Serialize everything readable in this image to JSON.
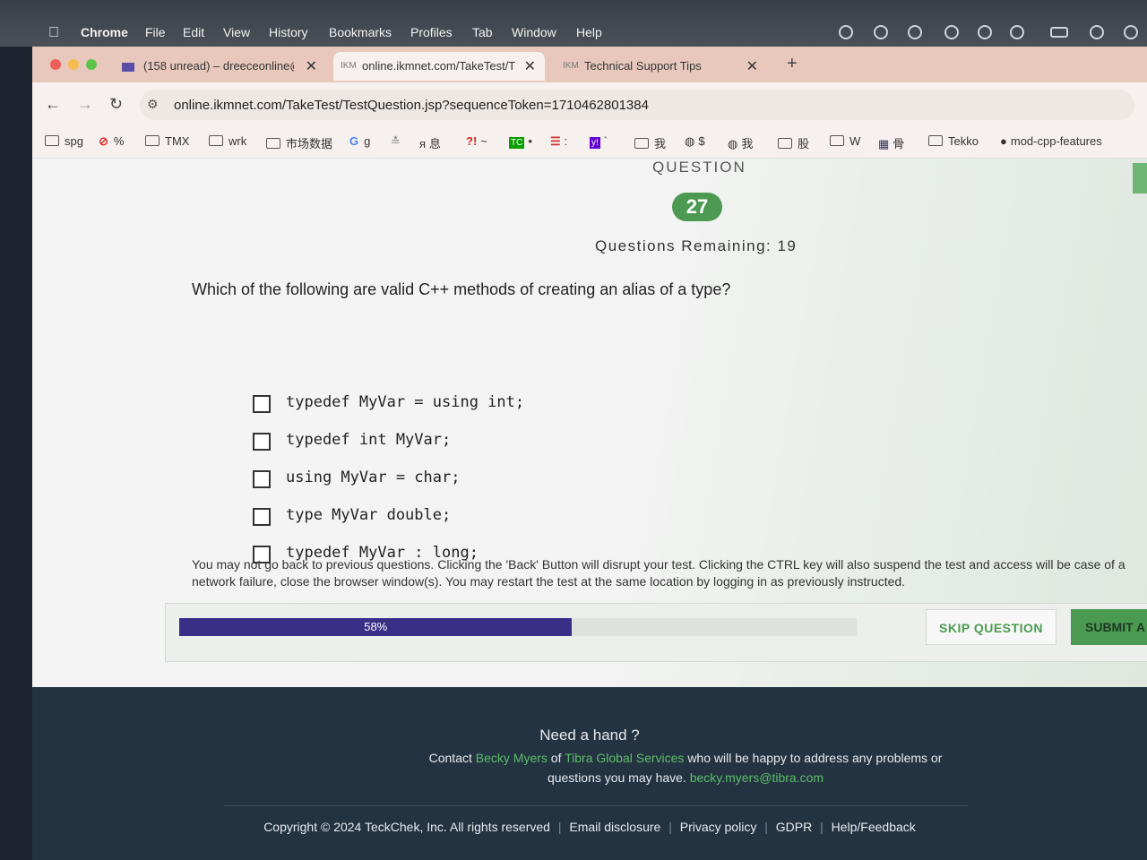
{
  "menubar": {
    "apple_icon": "apple-icon",
    "items": [
      "Chrome",
      "File",
      "Edit",
      "View",
      "History",
      "Bookmarks",
      "Profiles",
      "Tab",
      "Window",
      "Help"
    ]
  },
  "tabs": [
    {
      "icon": "mail-icon",
      "title": "(158 unread) – dreeceonline@"
    },
    {
      "icon": "IKM",
      "title": "online.ikmnet.com/TakeTest/T"
    },
    {
      "icon": "IKM",
      "title": "Technical Support Tips"
    }
  ],
  "new_tab_glyph": "+",
  "tab_close_glyph": "✕",
  "toolbar": {
    "back": "←",
    "forward": "→",
    "reload": "↻",
    "url": "online.ikmnet.com/TakeTest/TestQuestion.jsp?sequenceToken=1710462801384"
  },
  "bookmarks": [
    {
      "icon": "folder-icon",
      "label": "spg"
    },
    {
      "icon": "blocked-icon",
      "label": "%"
    },
    {
      "icon": "folder-icon",
      "label": "TMX"
    },
    {
      "icon": "folder-icon",
      "label": "wrk"
    },
    {
      "icon": "folder-icon",
      "label": "市场数据"
    },
    {
      "icon": "google-icon",
      "label": "g"
    },
    {
      "icon": "site-icon",
      "label": ""
    },
    {
      "icon": "site-icon",
      "label": "息"
    },
    {
      "icon": "site-icon",
      "label": "~"
    },
    {
      "icon": "site-icon",
      "label": "•"
    },
    {
      "icon": "site-icon",
      "label": ":"
    },
    {
      "icon": "yahoo-icon",
      "label": "`"
    },
    {
      "icon": "folder-icon",
      "label": "我"
    },
    {
      "icon": "globe-icon",
      "label": "$"
    },
    {
      "icon": "globe-icon",
      "label": "我"
    },
    {
      "icon": "folder-icon",
      "label": "股"
    },
    {
      "icon": "folder-icon",
      "label": "W"
    },
    {
      "icon": "grid-icon",
      "label": "骨"
    },
    {
      "icon": "folder-icon",
      "label": "Tekko"
    },
    {
      "icon": "github-icon",
      "label": "mod-cpp-features"
    }
  ],
  "question": {
    "heading": "QUESTION",
    "number": "27",
    "remaining": "Questions Remaining: 19",
    "text": "Which of the following are valid C++ methods of creating an alias of a type?",
    "options": [
      "typedef MyVar = using int;",
      "typedef int MyVar;",
      "using MyVar = char;",
      "type MyVar double;",
      "typedef MyVar : long;"
    ],
    "warning": "You may not go back to previous questions. Clicking the 'Back' Button will disrupt your test. Clicking the CTRL key will also suspend the test and access will be case of a network failure, close the browser window(s). You may restart the test at the same location by logging in as previously instructed."
  },
  "progress": {
    "value": 0.58,
    "label": "58%"
  },
  "actions": {
    "skip": "SKIP QUESTION",
    "submit": "SUBMIT A"
  },
  "footer": {
    "heading": "Need a hand ?",
    "contact_prefix": "Contact",
    "contact_name": "Becky Myers",
    "contact_of": "of",
    "company": "Tibra Global Services",
    "contact_suffix": "who will be happy to address any problems or questions you may have.",
    "email": "becky.myers@tibra.com",
    "copyright": "Copyright © 2024 TeckChek, Inc. All rights reserved",
    "links": [
      "Email disclosure",
      "Privacy policy",
      "GDPR",
      "Help/Feedback"
    ],
    "separator": "|"
  },
  "colors": {
    "accent_green": "#4c9a52",
    "progress_purple": "#3a2f86",
    "footer_bg": "#243342",
    "link_green": "#5cbd68"
  }
}
